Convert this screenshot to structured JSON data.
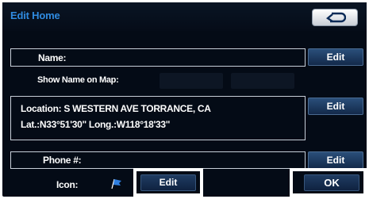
{
  "header": {
    "title": "Edit Home",
    "back_icon": "return-arrow-icon"
  },
  "name_row": {
    "label": "Name:",
    "edit_label": "Edit"
  },
  "show_name_row": {
    "label": "Show Name on Map:"
  },
  "location_row": {
    "line1": "Location:  S WESTERN AVE  TORRANCE, CA",
    "line2": "Lat.:N33°51'30\"    Long.:W118°18'33\"",
    "edit_label": "Edit"
  },
  "phone_row": {
    "label": "Phone #:",
    "edit_label": "Edit"
  },
  "icon_row": {
    "label": "Icon:",
    "icon": "blue-flag-icon",
    "edit_label": "Edit"
  },
  "ok_button": {
    "label": "OK"
  },
  "colors": {
    "background": "#040b16",
    "title": "#2f8be0",
    "button": "#1f3c62",
    "highlight_outline": "#ffffff"
  }
}
